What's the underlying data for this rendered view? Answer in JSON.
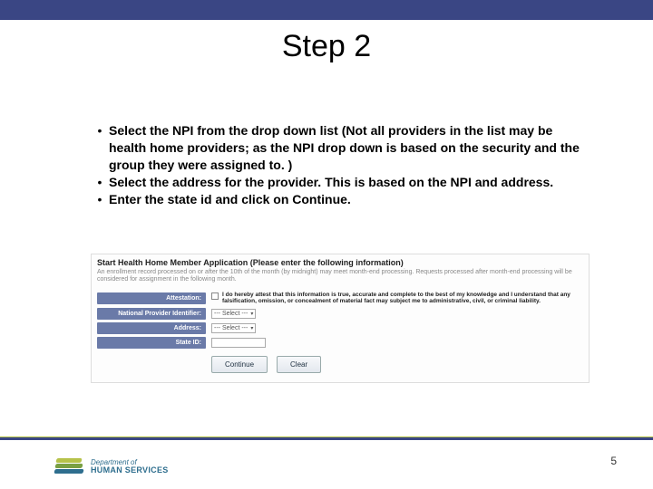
{
  "title": "Step 2",
  "bullets": [
    "Select the NPI from the drop down list  (Not all providers in the list may be health home providers; as the NPI drop down is based on the security and the group they were assigned to. )",
    "Select the address for the provider.  This is based on the NPI and address.",
    "Enter the state id and click on Continue."
  ],
  "form": {
    "heading": "Start Health Home Member Application (Please enter the following information)",
    "note": "An enrollment record processed on or after the 10th of the month (by midnight) may meet month-end processing. Requests processed after month-end processing will be considered for assignment in the following month.",
    "rows": {
      "attestation_label": "Attestation:",
      "attestation_text": "I do hereby attest that this information is true, accurate and complete to the best of my knowledge and I understand that any falsification, omission, or concealment of material fact may subject me to administrative, civil, or criminal liability.",
      "npi_label": "National Provider Identifier:",
      "npi_value": "--- Select ---",
      "address_label": "Address:",
      "address_value": "--- Select ---",
      "state_id_label": "State ID:"
    },
    "buttons": {
      "continue": "Continue",
      "clear": "Clear"
    }
  },
  "footer": {
    "dept_line1": "Department of",
    "dept_line2": "HUMAN SERVICES",
    "page": "5"
  }
}
